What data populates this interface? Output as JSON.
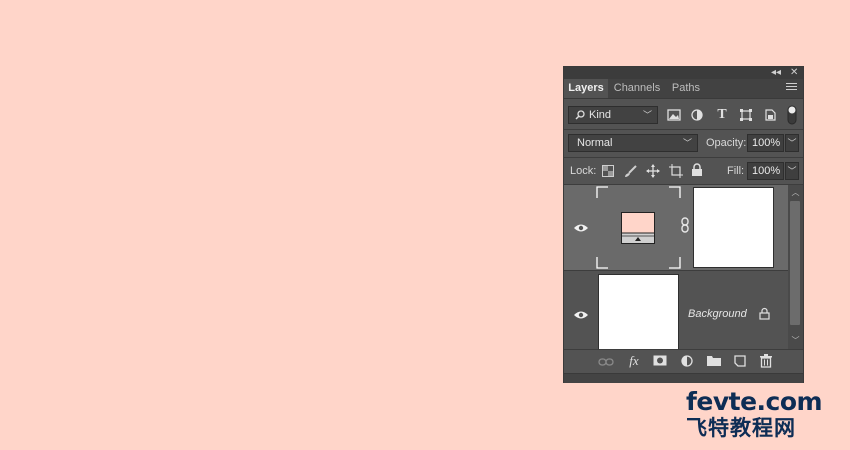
{
  "panel": {
    "title_controls": {
      "collapse": "◂◂",
      "close": "✕"
    },
    "tabs": [
      {
        "label": "Layers",
        "active": true
      },
      {
        "label": "Channels",
        "active": false
      },
      {
        "label": "Paths",
        "active": false
      }
    ],
    "filter": {
      "kind_label": "Kind",
      "icons": [
        "image-filter-icon",
        "adjustment-filter-icon",
        "type-filter-icon",
        "shape-filter-icon",
        "smart-object-filter-icon",
        "filter-toggle-icon"
      ]
    },
    "blend": {
      "mode": "Normal",
      "opacity_label": "Opacity:",
      "opacity_value": "100%"
    },
    "lock": {
      "label": "Lock:",
      "icons": [
        "lock-transparent-pixels-icon",
        "lock-image-pixels-icon",
        "lock-position-icon",
        "lock-artboard-icon",
        "lock-all-icon"
      ],
      "fill_label": "Fill:",
      "fill_value": "100%"
    },
    "layers": [
      {
        "type": "adjustment",
        "visible": true,
        "selected": true,
        "name": ""
      },
      {
        "type": "background",
        "visible": true,
        "selected": false,
        "name": "Background",
        "locked": true
      }
    ],
    "bottom_icons": [
      "link-layers-icon",
      "fx-icon",
      "add-mask-icon",
      "new-fill-adjustment-icon",
      "new-group-icon",
      "new-layer-icon",
      "delete-layer-icon"
    ],
    "bottom_fx_label": "fx",
    "colors": {
      "canvas": "#FFD5C9",
      "panel": "#535353",
      "selected_layer": "#6A6A6A",
      "swatch": "#FFD5C9"
    }
  },
  "watermark": {
    "line1": "fevte.com",
    "line2": "飞特教程网"
  }
}
